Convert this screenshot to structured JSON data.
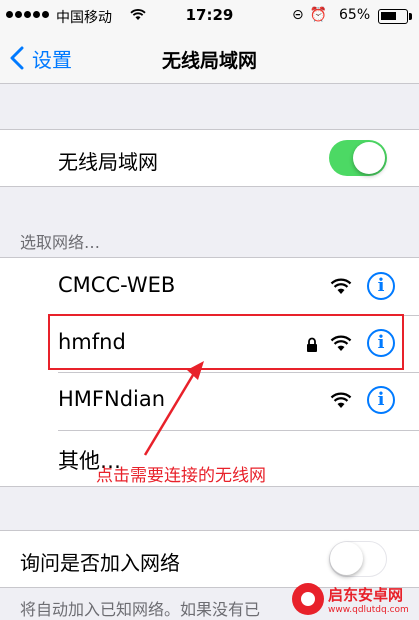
{
  "status_bar": {
    "carrier": "中国移动",
    "time": "17:29",
    "battery_percent": "65%",
    "battery_level": 0.65
  },
  "nav": {
    "back_label": "设置",
    "title": "无线局域网"
  },
  "wifi_toggle": {
    "label": "无线局域网",
    "state": "on"
  },
  "networks": {
    "header": "选取网络…",
    "items": [
      {
        "name": "CMCC-WEB",
        "locked": false
      },
      {
        "name": "hmfnd",
        "locked": true
      },
      {
        "name": "HMFNdian",
        "locked": false
      },
      {
        "name": "其他…"
      }
    ]
  },
  "annotation": {
    "text": "点击需要连接的无线网",
    "color": "#e8212a"
  },
  "ask_join": {
    "label": "询问是否加入网络",
    "state": "off"
  },
  "footer": {
    "text": "将自动加入已知网络。如果没有已"
  },
  "watermark": {
    "title": "启东安卓网",
    "url": "www.qdlutdq.com"
  },
  "colors": {
    "accent": "#007aff",
    "toggle_on": "#4cd964",
    "annotation": "#e8212a",
    "background": "#efeff4"
  },
  "icons": [
    "signal-dots-icon",
    "wifi-icon",
    "rotation-lock-icon",
    "alarm-icon",
    "battery-icon",
    "back-chevron-icon",
    "lock-icon",
    "info-icon",
    "arrow-icon"
  ]
}
